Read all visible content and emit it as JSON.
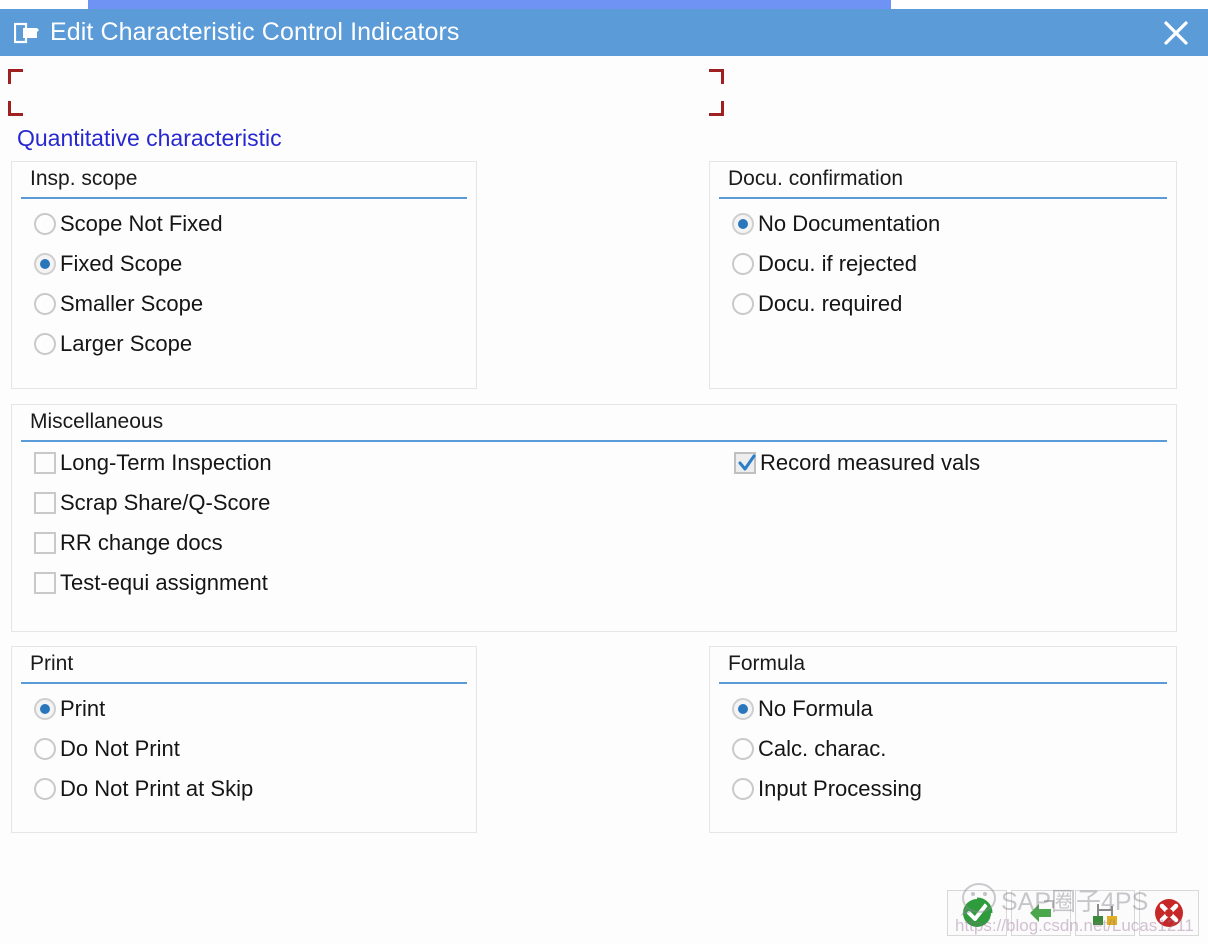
{
  "window": {
    "title": "Edit Characteristic Control Indicators",
    "title_icon": "edit-document-icon",
    "close_icon": "close-icon",
    "titlebar_color": "#5b9bd8",
    "accent_strip_color": "#6f93f5"
  },
  "heading": {
    "text": "Quantitative characteristic",
    "color": "#2828d0"
  },
  "groups": {
    "insp_scope": {
      "title": "Insp. scope",
      "type": "radio",
      "options": [
        {
          "label": "Scope Not Fixed",
          "checked": false
        },
        {
          "label": "Fixed Scope",
          "checked": true
        },
        {
          "label": "Smaller Scope",
          "checked": false
        },
        {
          "label": "Larger Scope",
          "checked": false
        }
      ]
    },
    "docu_confirmation": {
      "title": "Docu. confirmation",
      "type": "radio",
      "options": [
        {
          "label": "No Documentation",
          "checked": true
        },
        {
          "label": "Docu. if rejected",
          "checked": false
        },
        {
          "label": "Docu. required",
          "checked": false
        }
      ]
    },
    "miscellaneous": {
      "title": "Miscellaneous",
      "type": "checkbox",
      "left_options": [
        {
          "label": "Long-Term Inspection",
          "checked": false
        },
        {
          "label": "Scrap Share/Q-Score",
          "checked": false
        },
        {
          "label": "RR change docs",
          "checked": false
        },
        {
          "label": "Test-equi assignment",
          "checked": false
        }
      ],
      "right_options": [
        {
          "label": "Record measured vals",
          "checked": true
        }
      ]
    },
    "print": {
      "title": "Print",
      "type": "radio",
      "options": [
        {
          "label": "Print",
          "checked": true
        },
        {
          "label": "Do Not Print",
          "checked": false
        },
        {
          "label": "Do Not Print at Skip",
          "checked": false
        }
      ]
    },
    "formula": {
      "title": "Formula",
      "type": "radio",
      "options": [
        {
          "label": "No Formula",
          "checked": true
        },
        {
          "label": "Calc. charac.",
          "checked": false
        },
        {
          "label": "Input Processing",
          "checked": false
        }
      ]
    }
  },
  "toolbar": {
    "buttons": [
      {
        "icon": "green-check-confirm-icon",
        "color": "#2e9b3c"
      },
      {
        "icon": "green-back-arrow-icon",
        "color": "#4ca64c"
      },
      {
        "icon": "hierarchy-exit-icon",
        "color": "#3a8a3a"
      },
      {
        "icon": "red-cancel-x-icon",
        "color": "#c62828"
      }
    ]
  },
  "watermark": {
    "brand": "SAP圈子4PS",
    "url": "https://blog.csdn.net/Lucas1211",
    "logo_icon": "wechat-logo-icon"
  }
}
